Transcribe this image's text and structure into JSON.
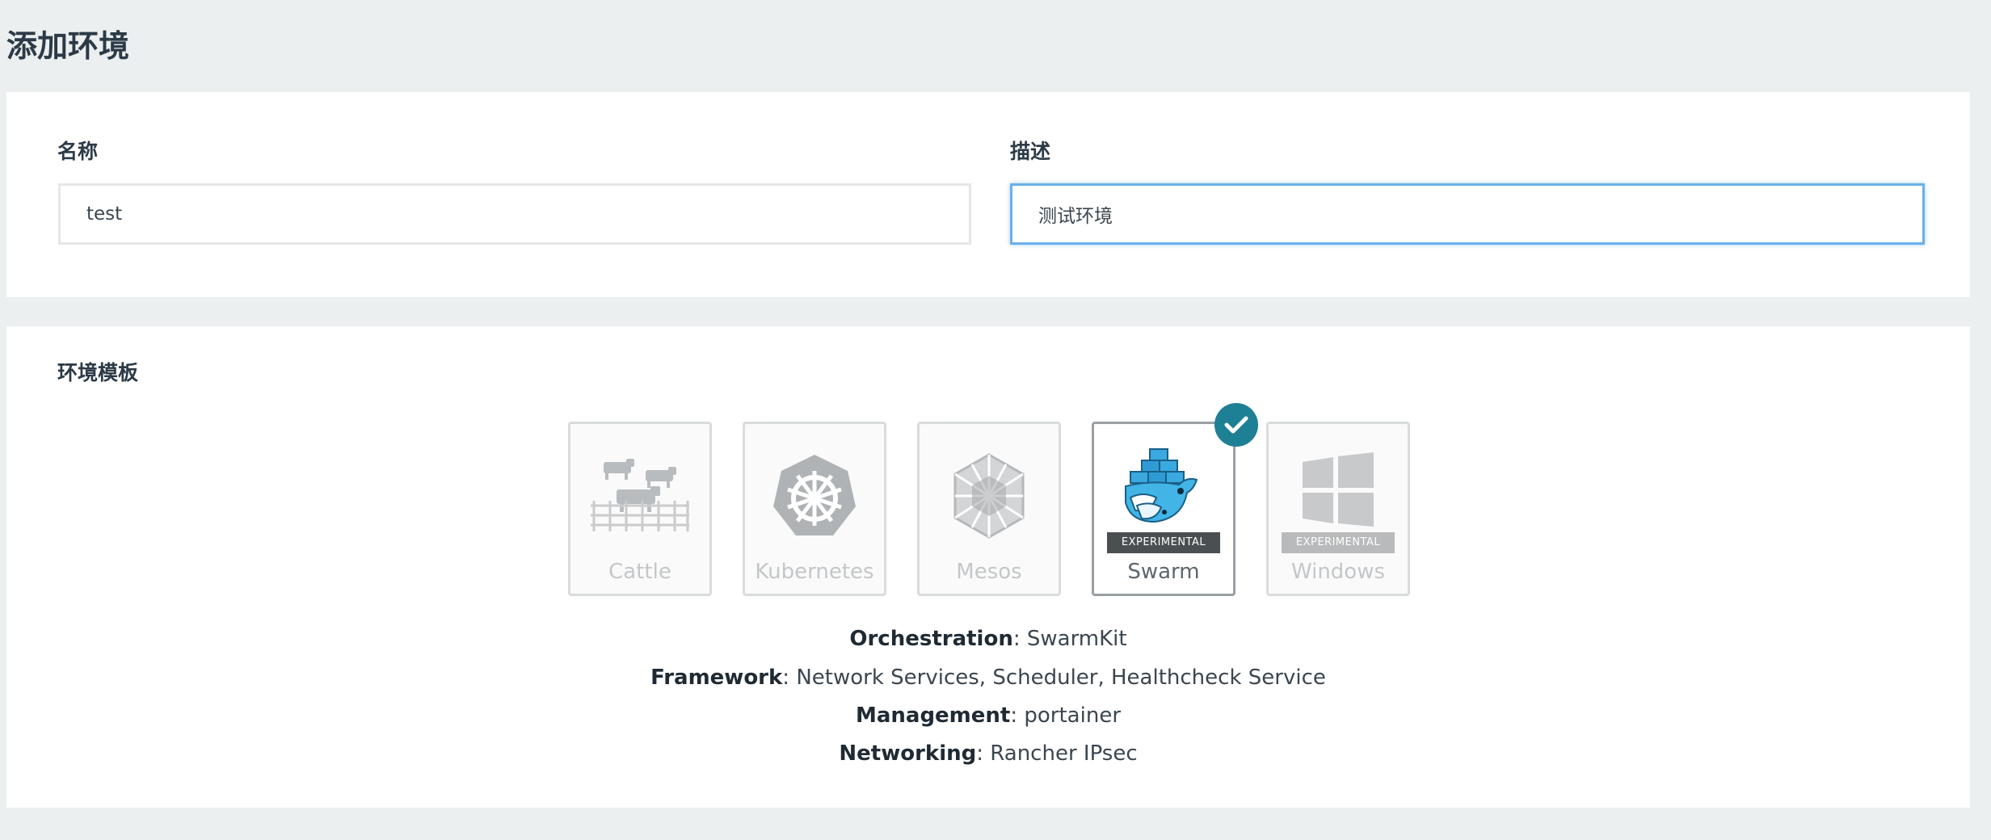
{
  "page": {
    "title": "添加环境"
  },
  "form": {
    "name_label": "名称",
    "name_value": "test",
    "description_label": "描述",
    "description_value": "测试环境"
  },
  "templates": {
    "section_title": "环境模板",
    "items": [
      {
        "label": "Cattle",
        "icon": "cattle-icon",
        "selected": false
      },
      {
        "label": "Kubernetes",
        "icon": "kubernetes-icon",
        "selected": false
      },
      {
        "label": "Mesos",
        "icon": "mesos-icon",
        "selected": false
      },
      {
        "label": "Swarm",
        "icon": "swarm-icon",
        "badge": "EXPERIMENTAL",
        "selected": true
      },
      {
        "label": "Windows",
        "icon": "windows-icon",
        "badge": "EXPERIMENTAL",
        "selected": false
      }
    ]
  },
  "details": [
    {
      "key": "Orchestration",
      "value": "SwarmKit"
    },
    {
      "key": "Framework",
      "value": "Network Services, Scheduler, Healthcheck Service"
    },
    {
      "key": "Management",
      "value": "portainer"
    },
    {
      "key": "Networking",
      "value": "Rancher IPsec"
    }
  ],
  "colors": {
    "background": "#ebeff0",
    "accent_check": "#1e8094",
    "focus_border": "#6ab0ea"
  }
}
